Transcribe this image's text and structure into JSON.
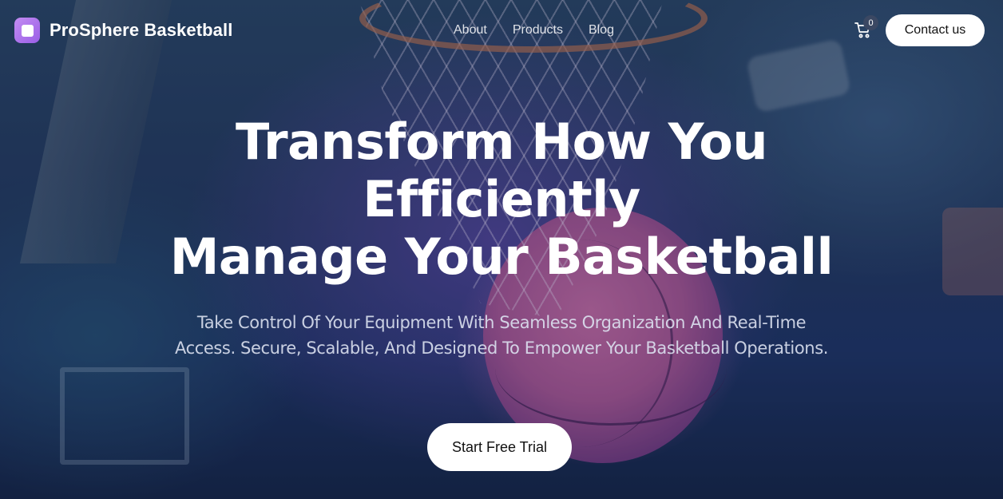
{
  "brand": {
    "name": "ProSphere Basketball",
    "icon": "app-logo-icon"
  },
  "nav": {
    "items": [
      "About",
      "Products",
      "Blog"
    ]
  },
  "cart": {
    "icon": "cart-icon",
    "count": "0"
  },
  "header": {
    "contact_label": "Contact us"
  },
  "hero": {
    "title_lines": [
      "Transform How You",
      "Efficiently",
      "Manage Your Basketball"
    ],
    "subtitle": "Take Control Of Your Equipment With Seamless Organization And Real-Time Access. Secure, Scalable, And Designed To Empower Your Basketball Operations.",
    "cta_label": "Start Free Trial"
  },
  "colors": {
    "accent": "#a66ce8",
    "button_bg": "#ffffff",
    "button_text": "#111111"
  }
}
